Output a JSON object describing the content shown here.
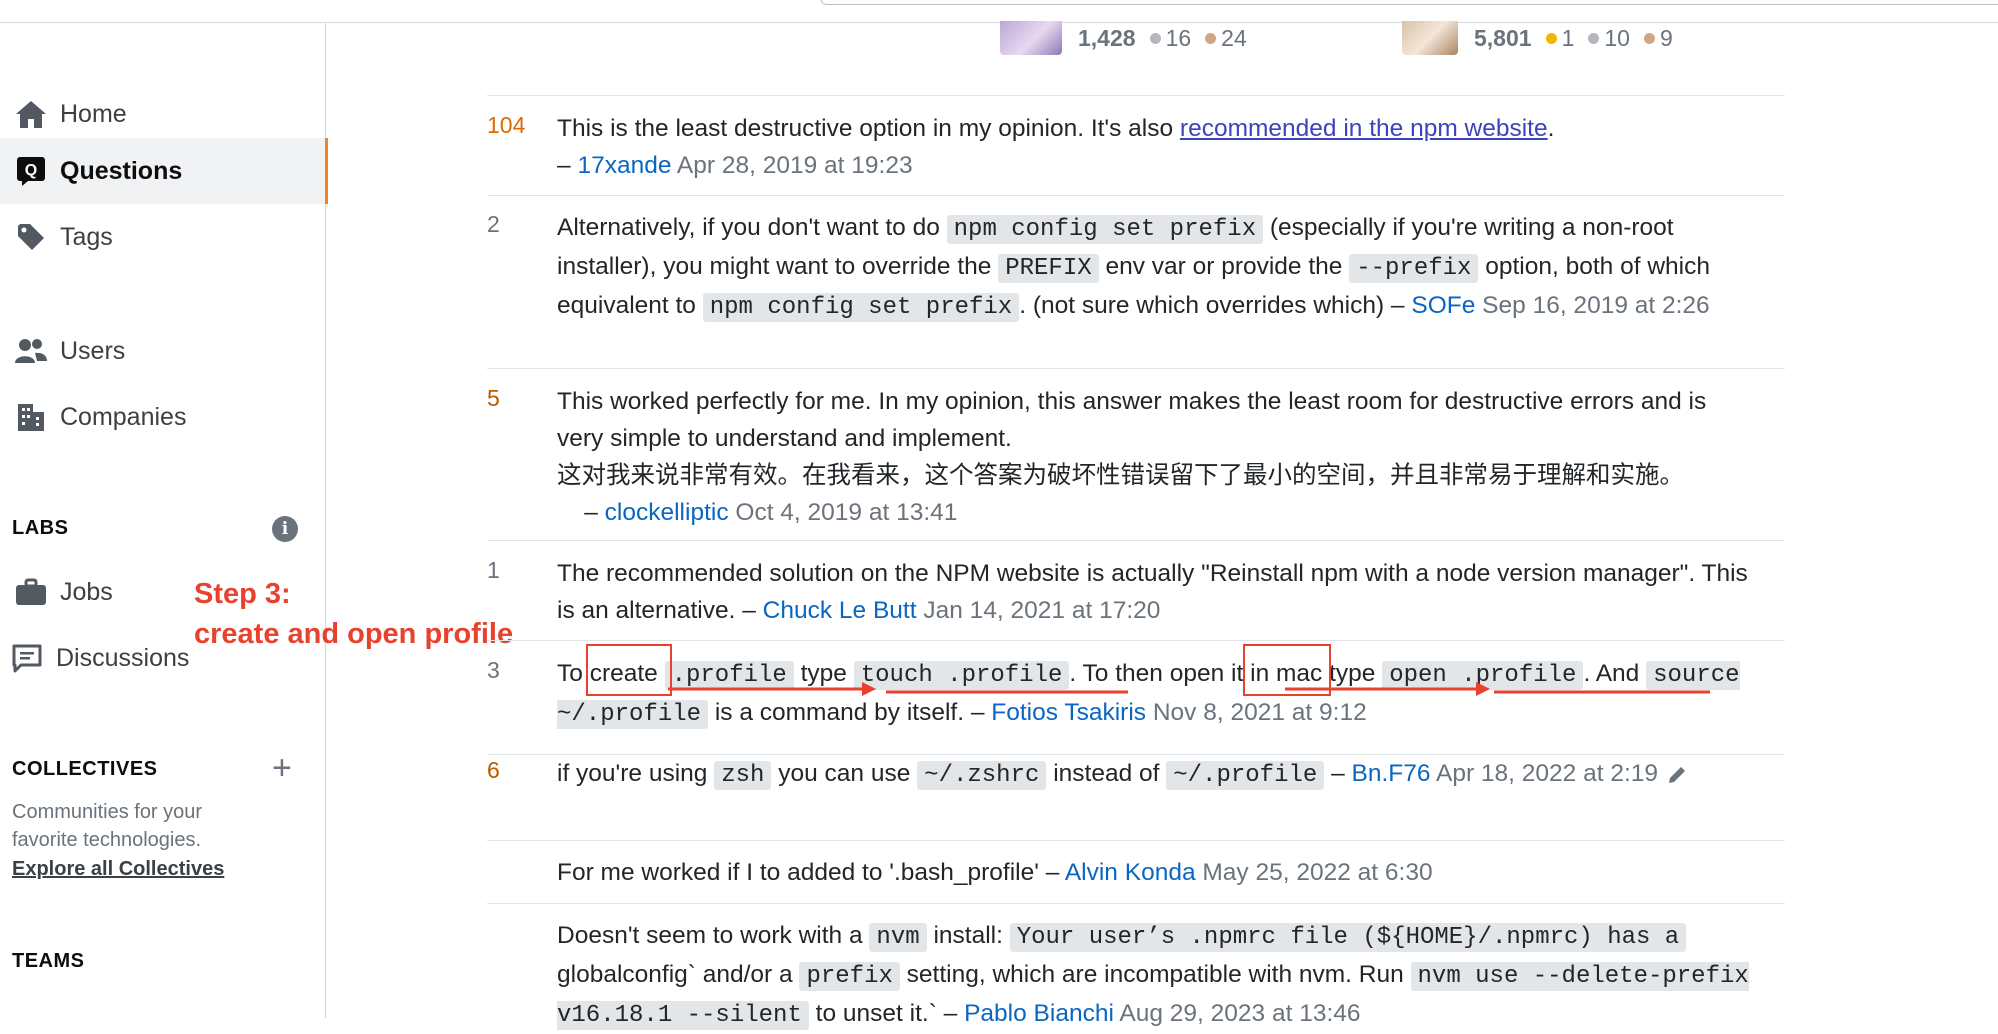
{
  "sidebar": {
    "nav": [
      {
        "label": "Home",
        "icon": "home-icon"
      },
      {
        "label": "Questions",
        "icon": "questions-icon",
        "active": true
      },
      {
        "label": "Tags",
        "icon": "tag-icon"
      },
      {
        "label": "Users",
        "icon": "users-icon"
      },
      {
        "label": "Companies",
        "icon": "building-icon"
      }
    ],
    "labs_title": "LABS",
    "labs": [
      {
        "label": "Jobs",
        "icon": "briefcase-icon"
      },
      {
        "label": "Discussions",
        "icon": "discussions-icon"
      }
    ],
    "collectives_title": "COLLECTIVES",
    "collectives_desc": "Communities for your favorite technologies.",
    "explore_link": "Explore all Collectives",
    "teams_title": "TEAMS"
  },
  "annotation": {
    "line1": "Step 3:",
    "line2": "create and open profile",
    "color": "#e8412d"
  },
  "users": [
    {
      "rep": "1,428",
      "silver": "16",
      "bronze": "24"
    },
    {
      "rep": "5,801",
      "gold": "1",
      "silver": "10",
      "bronze": "9"
    }
  ],
  "comments": [
    {
      "score": "104",
      "text": "This is the least destructive option in my opinion. It's also ",
      "link": "recommended in the npm website",
      "text2": ".",
      "author": "17xande",
      "date": "Apr 28, 2019 at 19:23"
    },
    {
      "score": "2",
      "t1": "Alternatively, if you don't want to do ",
      "c1": "npm config set prefix",
      "t2": " (especially if you're writing a non-root installer), you might want to override the ",
      "c2": "PREFIX",
      "t3": " env var or provide the ",
      "c3": "--prefix",
      "t4": " option, both of which equivalent to ",
      "c4": "npm config set prefix",
      "t5": ". (not sure which overrides which) – ",
      "author": "SOFe",
      "date": "Sep 16, 2019 at 2:26"
    },
    {
      "score": "5",
      "text": "This worked perfectly for me. In my opinion, this answer makes the least room for destructive errors and is very simple to understand and implement.",
      "text_zh": "这对我来说非常有效。在我看来，这个答案为破坏性错误留下了最小的空间，并且非常易于理解和实施。",
      "author": "clockelliptic",
      "date": "Oct 4, 2019 at 13:41"
    },
    {
      "score": "1",
      "text": "The recommended solution on the NPM website is actually \"Reinstall npm with a node version manager\". This is an alternative. – ",
      "author": "Chuck Le Butt",
      "date": "Jan 14, 2021 at 17:20"
    },
    {
      "score": "3",
      "t1": "To ",
      "w1": "create",
      "c1": ".profile",
      "t2": " type ",
      "c2": "touch .profile",
      "t3": ". To then ",
      "w2": "open it",
      "t4": " in mac type ",
      "c3": "open .profile",
      "t5": ". And ",
      "c4": "source ~/.profile",
      "t6": " is a command by itself. – ",
      "author": "Fotios Tsakiris",
      "date": "Nov 8, 2021 at 9:12"
    },
    {
      "score": "6",
      "t1": "if you're using ",
      "c1": "zsh",
      "t2": " you can use ",
      "c2": "~/.zshrc",
      "t3": " instead of ",
      "c3": "~/.profile",
      "t4": " – ",
      "author": "Bn.F76",
      "date": "Apr 18, 2022 at 2:19"
    },
    {
      "score": "",
      "text": "For me worked if I to added to '.bash_profile' – ",
      "author": "Alvin Konda",
      "date": "May 25, 2022 at 6:30"
    },
    {
      "score": "",
      "t1": "Doesn't seem to work with a ",
      "c1": "nvm",
      "t2": " install: ",
      "c2": "Your user’s .npmrc file (${HOME}/.npmrc) has a ",
      "t3": "globalconfig` and/or a ",
      "c3": "prefix",
      "t4": " setting, which are incompatible with nvm. Run ",
      "c4": "nvm use --delete-prefix v16.18.1 --silent",
      "t5": " to unset it.` – ",
      "author": "Pablo Bianchi",
      "date": "Aug 29, 2023 at 13:46"
    }
  ]
}
